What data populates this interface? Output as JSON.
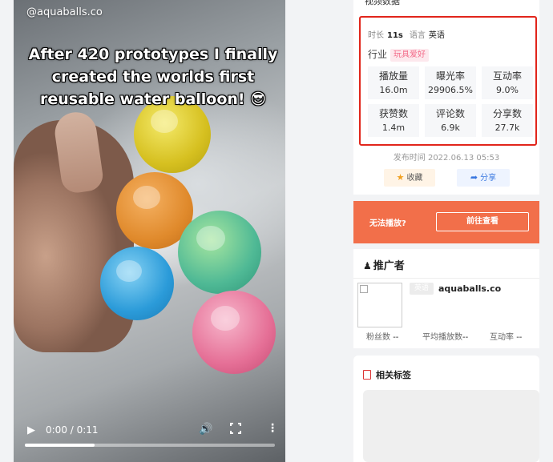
{
  "video": {
    "handle": "@aquaballs.co",
    "caption_lines": [
      "After 420 prototypes I finally",
      "created the worlds first",
      "reusable water balloon! 😎"
    ],
    "time": "0:00 / 0:11",
    "progress": 0.28
  },
  "info": {
    "cut_title": "视频数据",
    "duration_label": "时长",
    "duration_value": "11s",
    "language_label": "语言",
    "language_value": "英语",
    "industry_label": "行业",
    "industry_tag": "玩具爱好",
    "stats": [
      {
        "label": "播放量",
        "value": "16.0m"
      },
      {
        "label": "曝光率",
        "value": "29906.5%"
      },
      {
        "label": "互动率",
        "value": "9.0%"
      },
      {
        "label": "获赞数",
        "value": "1.4m"
      },
      {
        "label": "评论数",
        "value": "6.9k"
      },
      {
        "label": "分享数",
        "value": "27.7k"
      }
    ],
    "publish_time": "发布时间 2022.06.13 05:53",
    "favorite_label": "收藏",
    "share_label": "分享"
  },
  "banner": {
    "text": "无法播放?",
    "button": "前往查看"
  },
  "promoter": {
    "title": "推广者",
    "language_chip": "英语",
    "name": "aquaballs.co",
    "fans_label": "粉丝数",
    "fans_value": "--",
    "avg_play_label": "平均播放数",
    "avg_play_value": "--",
    "engagement_label": "互动率",
    "engagement_value": "--"
  },
  "tags": {
    "title": "相关标签"
  },
  "colors": {
    "highlight_border": "#e1251b",
    "banner_bg": "#f26f4a",
    "tag_pink": "#f36c8a",
    "share_blue": "#3a78e0"
  }
}
